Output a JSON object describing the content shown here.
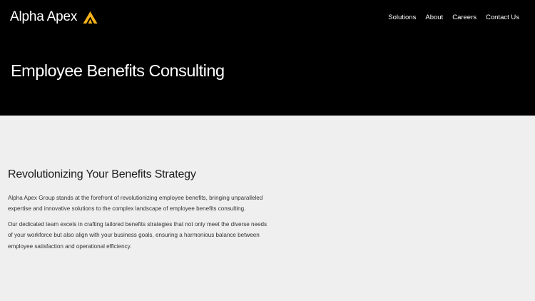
{
  "brand": {
    "name": "Alpha Apex",
    "logo_icon": "apex-triangle-icon",
    "accent_color": "#f5b21b"
  },
  "nav": {
    "items": [
      {
        "label": "Solutions"
      },
      {
        "label": "About"
      },
      {
        "label": "Careers"
      },
      {
        "label": "Contact Us"
      }
    ]
  },
  "hero": {
    "title": "Employee Benefits Consulting",
    "background": "#000000"
  },
  "main": {
    "heading": "Revolutionizing Your Benefits Strategy",
    "paragraphs": [
      "Alpha Apex Group stands at the forefront of revolutionizing employee benefits, bringing unparalleled expertise and innovative solutions to the complex landscape of employee benefits consulting.",
      "Our dedicated team excels in crafting tailored benefits strategies that not only meet the diverse needs of your workforce but also align with your business goals, ensuring a harmonious balance between employee satisfaction and operational efficiency."
    ],
    "background": "#efefef"
  }
}
